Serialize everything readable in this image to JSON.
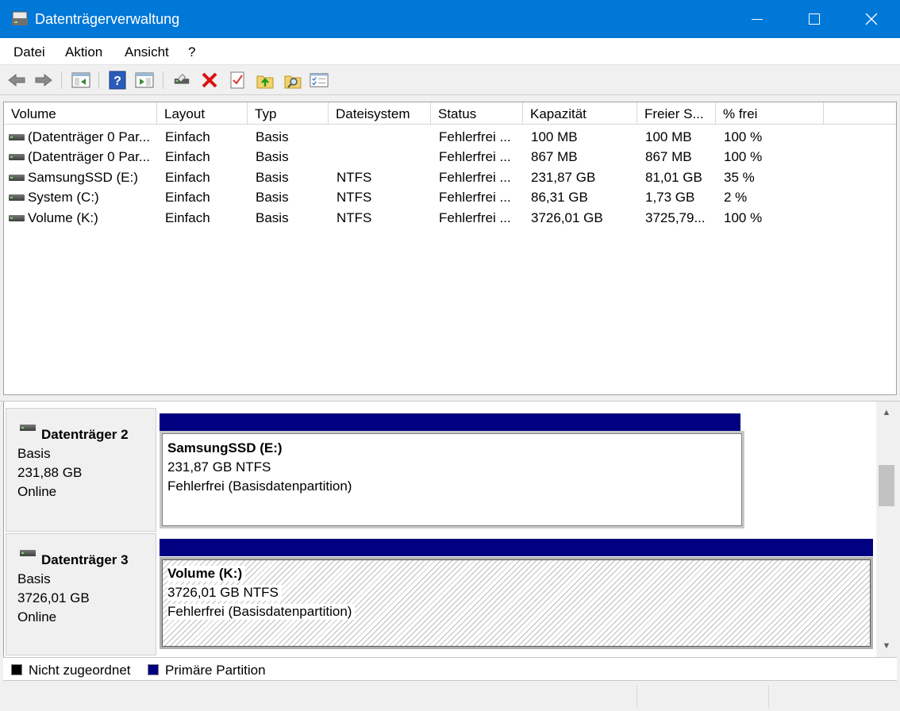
{
  "window": {
    "title": "Datenträgerverwaltung",
    "minimize": "—",
    "maximize": "☐",
    "close": "✕"
  },
  "menu": [
    "Datei",
    "Aktion",
    "Ansicht",
    "?"
  ],
  "toolbar": {
    "icons": [
      "back-arrow-icon",
      "forward-arrow-icon",
      "console-tree-icon",
      "help-icon",
      "properties-view-icon",
      "connect-disk-icon",
      "delete-icon",
      "checklist-icon",
      "folder-up-icon",
      "search-folder-icon",
      "settings-list-icon"
    ]
  },
  "columns": [
    "Volume",
    "Layout",
    "Typ",
    "Dateisystem",
    "Status",
    "Kapazität",
    "Freier S...",
    "% frei"
  ],
  "volumes": [
    {
      "volume": "(Datenträger 0 Par...",
      "layout": "Einfach",
      "typ": "Basis",
      "dateisystem": "",
      "status": "Fehlerfrei ...",
      "kapazitaet": "100 MB",
      "frei": "100 MB",
      "prozent": "100 %"
    },
    {
      "volume": "(Datenträger 0 Par...",
      "layout": "Einfach",
      "typ": "Basis",
      "dateisystem": "",
      "status": "Fehlerfrei ...",
      "kapazitaet": "867 MB",
      "frei": "867 MB",
      "prozent": "100 %"
    },
    {
      "volume": "SamsungSSD (E:)",
      "layout": "Einfach",
      "typ": "Basis",
      "dateisystem": "NTFS",
      "status": "Fehlerfrei ...",
      "kapazitaet": "231,87 GB",
      "frei": "81,01 GB",
      "prozent": "35 %"
    },
    {
      "volume": "System (C:)",
      "layout": "Einfach",
      "typ": "Basis",
      "dateisystem": "NTFS",
      "status": "Fehlerfrei ...",
      "kapazitaet": "86,31 GB",
      "frei": "1,73 GB",
      "prozent": "2 %"
    },
    {
      "volume": "Volume (K:)",
      "layout": "Einfach",
      "typ": "Basis",
      "dateisystem": "NTFS",
      "status": "Fehlerfrei ...",
      "kapazitaet": "3726,01 GB",
      "frei": "3725,79...",
      "prozent": "100 %"
    }
  ],
  "disks": [
    {
      "name": "Datenträger 2",
      "type": "Basis",
      "size": "231,88 GB",
      "state": "Online",
      "partition": {
        "name": "SamsungSSD  (E:)",
        "size": "231,87 GB NTFS",
        "status": "Fehlerfrei (Basisdatenpartition)"
      }
    },
    {
      "name": "Datenträger 3",
      "type": "Basis",
      "size": "3726,01 GB",
      "state": "Online",
      "partition": {
        "name": "Volume  (K:)",
        "size": "3726,01 GB NTFS",
        "status": "Fehlerfrei (Basisdatenpartition)"
      }
    }
  ],
  "legend": [
    {
      "label": "Nicht zugeordnet",
      "color": "#000000"
    },
    {
      "label": "Primäre Partition",
      "color": "#000080"
    }
  ],
  "colors": {
    "titlebar": "#0078d7",
    "primary_partition": "#000080",
    "unallocated": "#000000"
  }
}
